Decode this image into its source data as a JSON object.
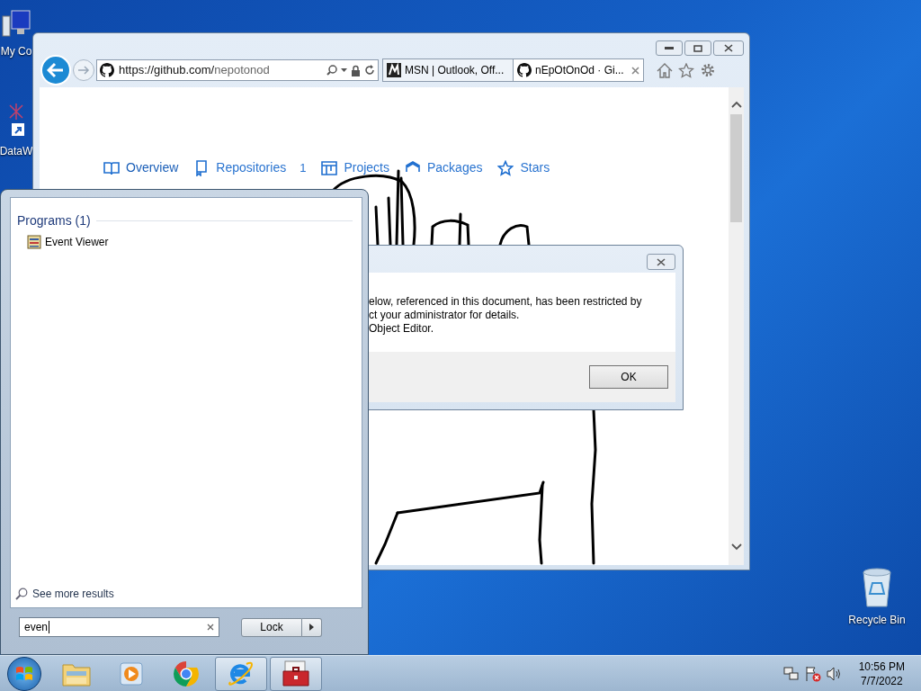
{
  "desktop_icons": [
    {
      "kind": "computer",
      "label": "My Co"
    },
    {
      "kind": "shortcut",
      "label": "DataW"
    },
    {
      "kind": "recycle",
      "label": "Recycle Bin"
    }
  ],
  "browser": {
    "url_host": "https://github.com/",
    "url_path": "nepotonod",
    "tabs": [
      {
        "title": "MSN | Outlook, Off...",
        "kind": "msn",
        "selected": false
      },
      {
        "title": "nEpOtOnOd · Gi...",
        "kind": "github",
        "selected": true
      }
    ],
    "profile_nav": [
      {
        "kind": "book",
        "label": "Overview",
        "selected": true
      },
      {
        "kind": "repo",
        "label": "Repositories",
        "count": "1",
        "selected": false
      },
      {
        "kind": "project",
        "label": "Projects",
        "selected": false
      },
      {
        "kind": "package",
        "label": "Packages",
        "selected": false
      },
      {
        "kind": "star",
        "label": "Stars",
        "selected": false
      }
    ]
  },
  "dialog": {
    "message_lines": [
      "elow, referenced in this document, has been restricted by",
      "ct your administrator for details.",
      "Object Editor."
    ],
    "button": "OK"
  },
  "start_menu": {
    "section": "Programs (1)",
    "results": [
      {
        "label": "Event Viewer"
      }
    ],
    "see_more": "See more results",
    "search_value": "even",
    "power_button": "Lock"
  },
  "taskbar": {
    "apps": [
      {
        "kind": "explorer",
        "selected": false
      },
      {
        "kind": "media",
        "selected": false
      },
      {
        "kind": "chrome",
        "selected": false
      },
      {
        "kind": "ie",
        "selected": true
      },
      {
        "kind": "toolbox",
        "selected": true
      }
    ],
    "time": "10:56 PM",
    "date": "7/7/2022"
  }
}
